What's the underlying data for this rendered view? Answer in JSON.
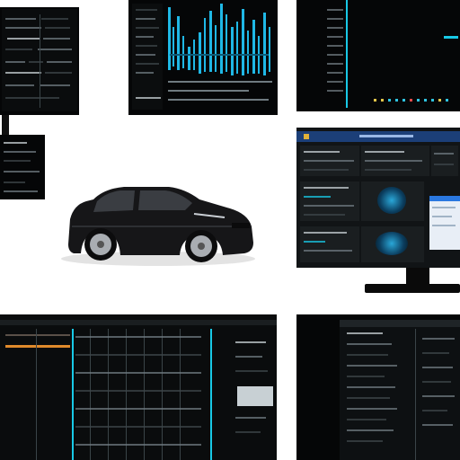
{
  "scene": {
    "subject": "car-illustration",
    "colors": {
      "background": "#ffffff",
      "panel": "#050607",
      "accent_cyan": "#18c9e6",
      "accent_blue": "#2a78e0",
      "accent_orange": "#e08a2c",
      "car_body": "#151517"
    }
  }
}
